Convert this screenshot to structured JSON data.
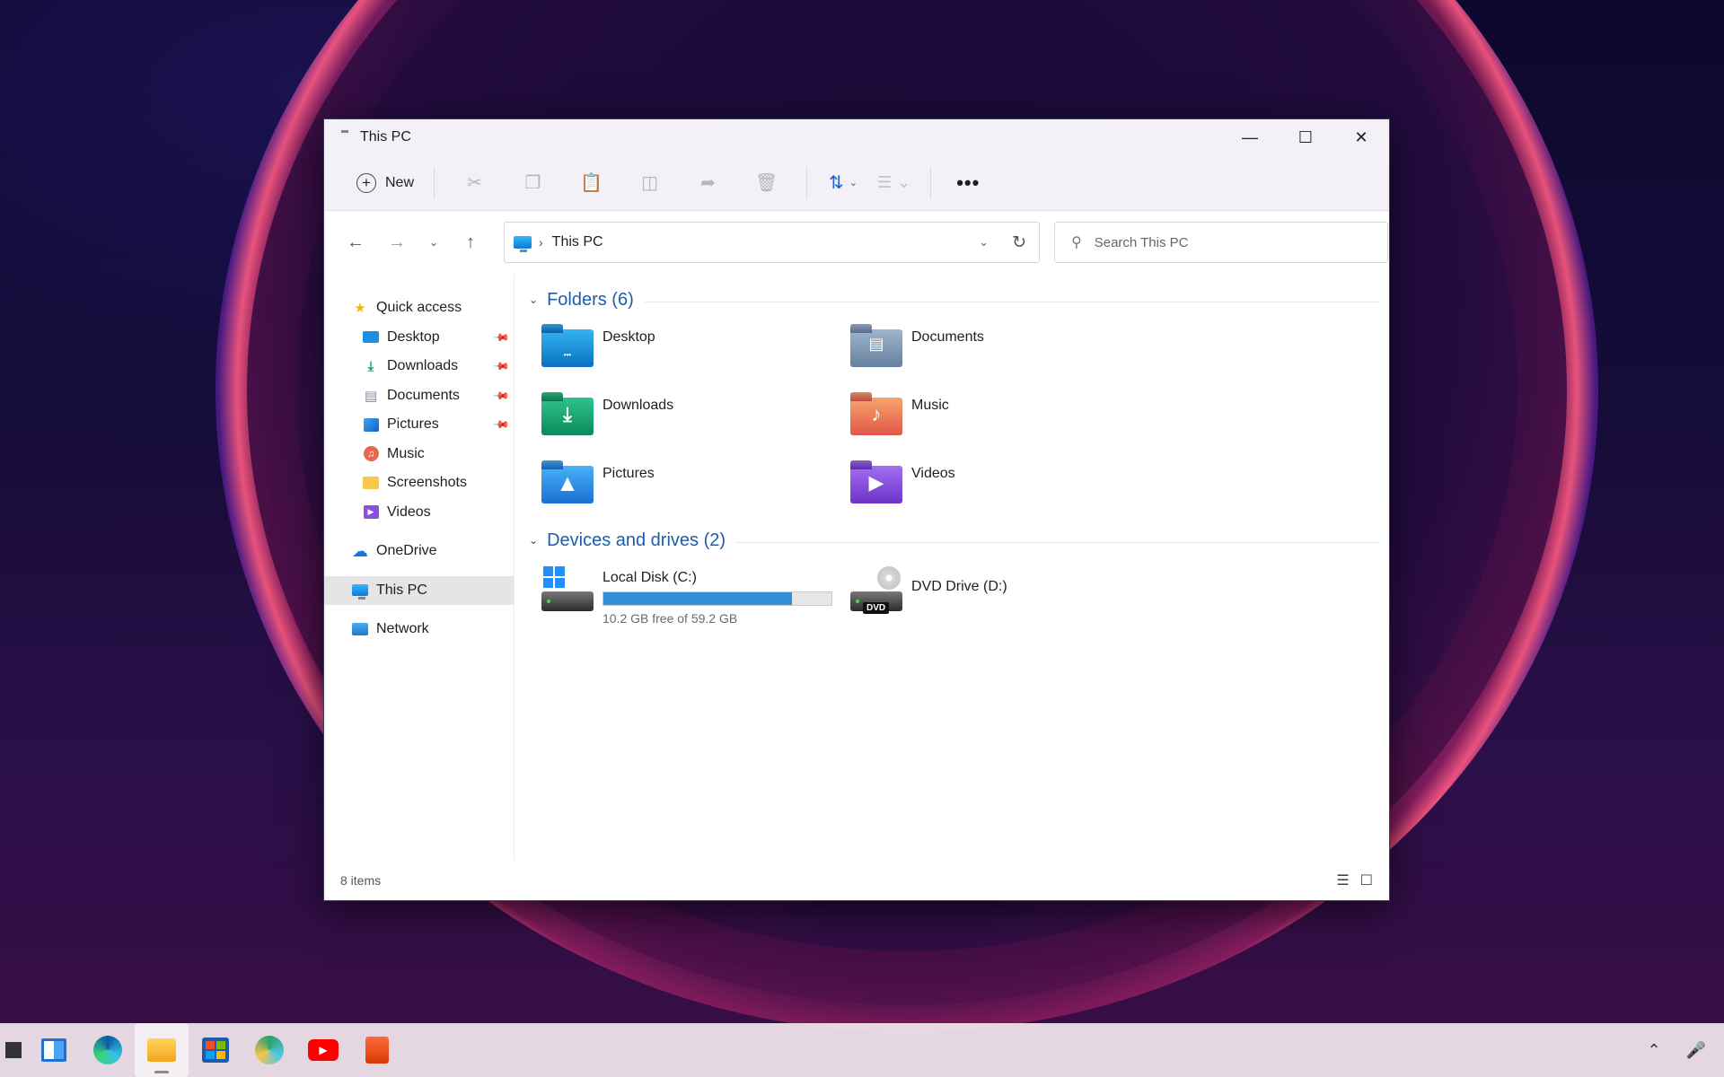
{
  "window": {
    "title": "This PC",
    "icon": "this-pc-icon"
  },
  "toolbar": {
    "new_label": "New",
    "icons": [
      "cut-icon",
      "copy-icon",
      "paste-icon",
      "rename-icon",
      "share-icon",
      "delete-icon"
    ],
    "sort": "sort-icon",
    "view": "view-icon",
    "more": "•••"
  },
  "address": {
    "crumb": "This PC"
  },
  "search": {
    "placeholder": "Search This PC"
  },
  "sidebar": {
    "quick_access": "Quick access",
    "items": [
      {
        "label": "Desktop",
        "pinned": true
      },
      {
        "label": "Downloads",
        "pinned": true
      },
      {
        "label": "Documents",
        "pinned": true
      },
      {
        "label": "Pictures",
        "pinned": true
      },
      {
        "label": "Music",
        "pinned": false
      },
      {
        "label": "Screenshots",
        "pinned": false
      },
      {
        "label": "Videos",
        "pinned": false
      }
    ],
    "onedrive": "OneDrive",
    "this_pc": "This PC",
    "network": "Network"
  },
  "folders": {
    "heading": "Folders (6)",
    "items": [
      {
        "label": "Desktop"
      },
      {
        "label": "Documents"
      },
      {
        "label": "Downloads"
      },
      {
        "label": "Music"
      },
      {
        "label": "Pictures"
      },
      {
        "label": "Videos"
      }
    ]
  },
  "drives": {
    "heading": "Devices and drives (2)",
    "c": {
      "label": "Local Disk (C:)",
      "free": "10.2 GB free of 59.2 GB",
      "used_fraction": 0.828
    },
    "d": {
      "label": "DVD Drive (D:)",
      "tag": "DVD"
    }
  },
  "status": {
    "count": "8 items"
  },
  "colors": {
    "accent": "#1a5eb0",
    "drive_bar": "#2f8fd8"
  }
}
